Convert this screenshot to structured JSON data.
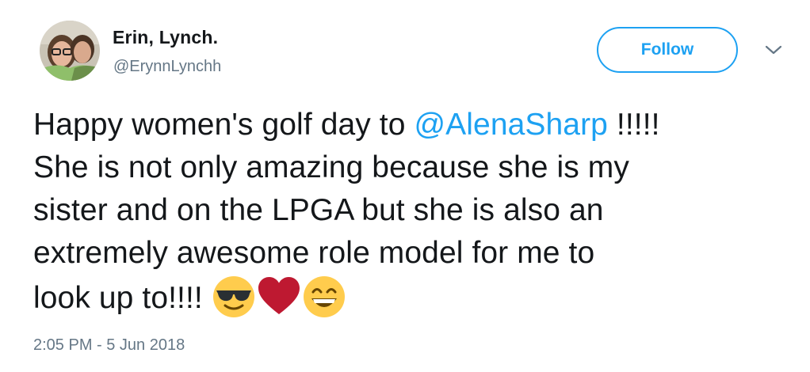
{
  "user": {
    "display_name": "Erin, Lynch.",
    "handle": "@ErynnLynchh",
    "avatar_icon": "profile-photo"
  },
  "header": {
    "follow_label": "Follow",
    "menu_icon": "chevron-down-icon"
  },
  "tweet": {
    "line1_pre": "Happy women's golf day to ",
    "mention": "@AlenaSharp",
    "line1_post": " !!!!!",
    "line2": "She is not only amazing because she is my",
    "line3": "sister and on the LPGA but she is also an",
    "line4": "extremely awesome role model for me to",
    "line5": "look up to!!!! ",
    "emojis": [
      "smiling-face-with-sunglasses",
      "red-heart",
      "grinning-face-with-smiling-eyes"
    ]
  },
  "timestamp": "2:05 PM - 5 Jun 2018",
  "colors": {
    "accent": "#1da1f2",
    "text": "#14171a",
    "secondary_text": "#657786"
  }
}
